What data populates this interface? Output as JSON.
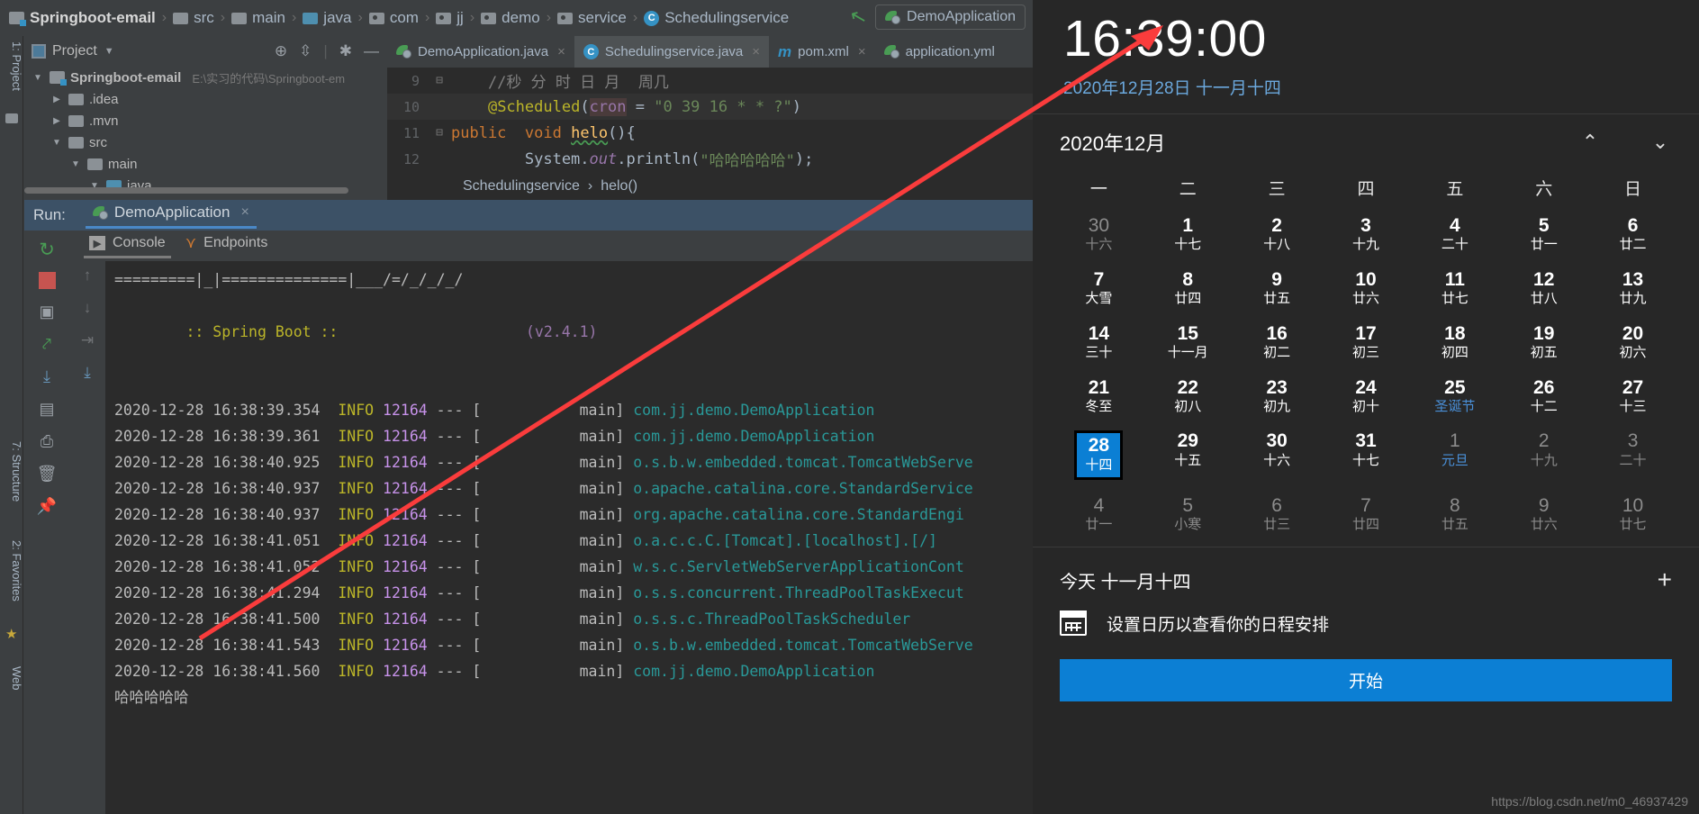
{
  "ide": {
    "breadcrumbs": [
      {
        "label": "Springboot-email",
        "icon": "module-icon",
        "bold": true
      },
      {
        "label": "src",
        "icon": "folder-icon"
      },
      {
        "label": "main",
        "icon": "folder-icon"
      },
      {
        "label": "java",
        "icon": "folder-blue-icon"
      },
      {
        "label": "com",
        "icon": "package-icon"
      },
      {
        "label": "jj",
        "icon": "package-icon"
      },
      {
        "label": "demo",
        "icon": "package-icon"
      },
      {
        "label": "service",
        "icon": "package-icon"
      },
      {
        "label": "Schedulingservice",
        "icon": "class-icon"
      }
    ],
    "toolbar": {
      "build_label": "build-hammer-icon",
      "run_config": "DemoApplication"
    },
    "left_strip": {
      "project_label": "1: Project",
      "structure_label": "7: Structure",
      "favorites_label": "2: Favorites",
      "web_label": "Web"
    },
    "project_panel": {
      "title": "Project",
      "tree": [
        {
          "label": "Springboot-email",
          "path": "E:\\实习的代码\\Springboot-em",
          "indent": 0,
          "arrow": "▼",
          "icon": "module-icon",
          "bold": true
        },
        {
          "label": ".idea",
          "indent": 1,
          "arrow": "▶",
          "icon": "folder-icon"
        },
        {
          "label": ".mvn",
          "indent": 1,
          "arrow": "▶",
          "icon": "folder-icon"
        },
        {
          "label": "src",
          "indent": 1,
          "arrow": "▼",
          "icon": "folder-icon"
        },
        {
          "label": "main",
          "indent": 2,
          "arrow": "▼",
          "icon": "folder-icon"
        },
        {
          "label": "java",
          "indent": 3,
          "arrow": "▼",
          "icon": "folder-blue-icon"
        }
      ]
    },
    "editor": {
      "tabs": [
        {
          "label": "DemoApplication.java",
          "icon": "spring-icon",
          "active": false,
          "close": "×"
        },
        {
          "label": "Schedulingservice.java",
          "icon": "class-icon",
          "active": true,
          "close": "×"
        },
        {
          "label": "pom.xml",
          "icon": "maven-icon",
          "active": false,
          "close": "×"
        },
        {
          "label": "application.yml",
          "icon": "spring-icon",
          "active": false,
          "close": ""
        }
      ],
      "lines": [
        {
          "no": "9",
          "fold": "⊟",
          "parts": [
            {
              "t": "    //秒 分 时 日 月  周几",
              "c": "k-comment"
            }
          ]
        },
        {
          "no": "10",
          "fold": "",
          "parts": [
            {
              "t": "    ",
              "c": "k-plain"
            },
            {
              "t": "@Scheduled",
              "c": "k-ann"
            },
            {
              "t": "(",
              "c": "k-plain"
            },
            {
              "t": "cron",
              "c": "k-par"
            },
            {
              "t": " = ",
              "c": "k-op"
            },
            {
              "t": "\"0 39 16 * * ?\"",
              "c": "k-str"
            },
            {
              "t": ")",
              "c": "k-plain"
            }
          ]
        },
        {
          "no": "11",
          "fold": "⊟",
          "parts": [
            {
              "t": "public",
              "c": "k-kw"
            },
            {
              "t": "  ",
              "c": "k-plain"
            },
            {
              "t": "void",
              "c": "k-kw"
            },
            {
              "t": " ",
              "c": "k-plain"
            },
            {
              "t": "helo",
              "c": "k-fn wavy"
            },
            {
              "t": "(){",
              "c": "k-plain"
            }
          ]
        },
        {
          "no": "12",
          "fold": "",
          "parts": [
            {
              "t": "        System.",
              "c": "k-plain"
            },
            {
              "t": "out",
              "c": "k-static"
            },
            {
              "t": ".println(",
              "c": "k-plain"
            },
            {
              "t": "\"哈哈哈哈哈\"",
              "c": "k-str"
            },
            {
              "t": ");",
              "c": "k-plain"
            }
          ]
        }
      ],
      "breadcrumb_class": "Schedulingservice",
      "breadcrumb_method": "helo()",
      "breadcrumb_sep": "›"
    },
    "run_window": {
      "run_label": "Run:",
      "config_name": "DemoApplication",
      "close": "×",
      "tabs": [
        {
          "label": "Console",
          "icon": "console-icon",
          "selected": true
        },
        {
          "label": "Endpoints",
          "icon": "endpoints-icon",
          "selected": false
        }
      ],
      "banner_line1": "=========|_|==============|___/=/_/_/_/",
      "banner_line2": ":: Spring Boot ::",
      "banner_version": "(v2.4.1)",
      "logs": [
        {
          "ts": "2020-12-28 16:38:39.354",
          "level": "INFO",
          "pid": "12164",
          "thread": "main",
          "cls": "com.jj.demo.DemoApplication"
        },
        {
          "ts": "2020-12-28 16:38:39.361",
          "level": "INFO",
          "pid": "12164",
          "thread": "main",
          "cls": "com.jj.demo.DemoApplication"
        },
        {
          "ts": "2020-12-28 16:38:40.925",
          "level": "INFO",
          "pid": "12164",
          "thread": "main",
          "cls": "o.s.b.w.embedded.tomcat.TomcatWebServe"
        },
        {
          "ts": "2020-12-28 16:38:40.937",
          "level": "INFO",
          "pid": "12164",
          "thread": "main",
          "cls": "o.apache.catalina.core.StandardService"
        },
        {
          "ts": "2020-12-28 16:38:40.937",
          "level": "INFO",
          "pid": "12164",
          "thread": "main",
          "cls": "org.apache.catalina.core.StandardEngi"
        },
        {
          "ts": "2020-12-28 16:38:41.051",
          "level": "INFO",
          "pid": "12164",
          "thread": "main",
          "cls": "o.a.c.c.C.[Tomcat].[localhost].[/]"
        },
        {
          "ts": "2020-12-28 16:38:41.052",
          "level": "INFO",
          "pid": "12164",
          "thread": "main",
          "cls": "w.s.c.ServletWebServerApplicationCont"
        },
        {
          "ts": "2020-12-28 16:38:41.294",
          "level": "INFO",
          "pid": "12164",
          "thread": "main",
          "cls": "o.s.s.concurrent.ThreadPoolTaskExecut"
        },
        {
          "ts": "2020-12-28 16:38:41.500",
          "level": "INFO",
          "pid": "12164",
          "thread": "main",
          "cls": "o.s.s.c.ThreadPoolTaskScheduler"
        },
        {
          "ts": "2020-12-28 16:38:41.543",
          "level": "INFO",
          "pid": "12164",
          "thread": "main",
          "cls": "o.s.b.w.embedded.tomcat.TomcatWebServe"
        },
        {
          "ts": "2020-12-28 16:38:41.560",
          "level": "INFO",
          "pid": "12164",
          "thread": "main",
          "cls": "com.jj.demo.DemoApplication"
        }
      ],
      "output_tail": "哈哈哈哈哈"
    }
  },
  "calendar": {
    "clock": "16:39:00",
    "date_line": "2020年12月28日 十一月十四",
    "month_title": "2020年12月",
    "nav_up": "⌃",
    "nav_down": "⌄",
    "weekdays": [
      "一",
      "二",
      "三",
      "四",
      "五",
      "六",
      "日"
    ],
    "weeks": [
      [
        {
          "n": "30",
          "s": "十六",
          "state": "muted"
        },
        {
          "n": "1",
          "s": "十七",
          "state": ""
        },
        {
          "n": "2",
          "s": "十八",
          "state": ""
        },
        {
          "n": "3",
          "s": "十九",
          "state": ""
        },
        {
          "n": "4",
          "s": "二十",
          "state": ""
        },
        {
          "n": "5",
          "s": "廿一",
          "state": ""
        },
        {
          "n": "6",
          "s": "廿二",
          "state": ""
        }
      ],
      [
        {
          "n": "7",
          "s": "大雪",
          "state": ""
        },
        {
          "n": "8",
          "s": "廿四",
          "state": ""
        },
        {
          "n": "9",
          "s": "廿五",
          "state": ""
        },
        {
          "n": "10",
          "s": "廿六",
          "state": ""
        },
        {
          "n": "11",
          "s": "廿七",
          "state": ""
        },
        {
          "n": "12",
          "s": "廿八",
          "state": ""
        },
        {
          "n": "13",
          "s": "廿九",
          "state": ""
        }
      ],
      [
        {
          "n": "14",
          "s": "三十",
          "state": ""
        },
        {
          "n": "15",
          "s": "十一月",
          "state": ""
        },
        {
          "n": "16",
          "s": "初二",
          "state": ""
        },
        {
          "n": "17",
          "s": "初三",
          "state": ""
        },
        {
          "n": "18",
          "s": "初四",
          "state": ""
        },
        {
          "n": "19",
          "s": "初五",
          "state": ""
        },
        {
          "n": "20",
          "s": "初六",
          "state": ""
        }
      ],
      [
        {
          "n": "21",
          "s": "冬至",
          "state": ""
        },
        {
          "n": "22",
          "s": "初八",
          "state": ""
        },
        {
          "n": "23",
          "s": "初九",
          "state": ""
        },
        {
          "n": "24",
          "s": "初十",
          "state": ""
        },
        {
          "n": "25",
          "s": "圣诞节",
          "state": "holiday"
        },
        {
          "n": "26",
          "s": "十二",
          "state": ""
        },
        {
          "n": "27",
          "s": "十三",
          "state": ""
        }
      ],
      [
        {
          "n": "28",
          "s": "十四",
          "state": "today"
        },
        {
          "n": "29",
          "s": "十五",
          "state": ""
        },
        {
          "n": "30",
          "s": "十六",
          "state": ""
        },
        {
          "n": "31",
          "s": "十七",
          "state": ""
        },
        {
          "n": "1",
          "s": "元旦",
          "state": "muted holiday"
        },
        {
          "n": "2",
          "s": "十九",
          "state": "muted"
        },
        {
          "n": "3",
          "s": "二十",
          "state": "muted"
        }
      ],
      [
        {
          "n": "4",
          "s": "廿一",
          "state": "muted"
        },
        {
          "n": "5",
          "s": "小寒",
          "state": "muted"
        },
        {
          "n": "6",
          "s": "廿三",
          "state": "muted"
        },
        {
          "n": "7",
          "s": "廿四",
          "state": "muted"
        },
        {
          "n": "8",
          "s": "廿五",
          "state": "muted"
        },
        {
          "n": "9",
          "s": "廿六",
          "state": "muted"
        },
        {
          "n": "10",
          "s": "廿七",
          "state": "muted"
        }
      ]
    ],
    "agenda_title": "今天 十一月十四",
    "add_label": "+",
    "agenda_text": "设置日历以查看你的日程安排",
    "start_button": "开始"
  },
  "watermark": "https://blog.csdn.net/m0_46937429"
}
